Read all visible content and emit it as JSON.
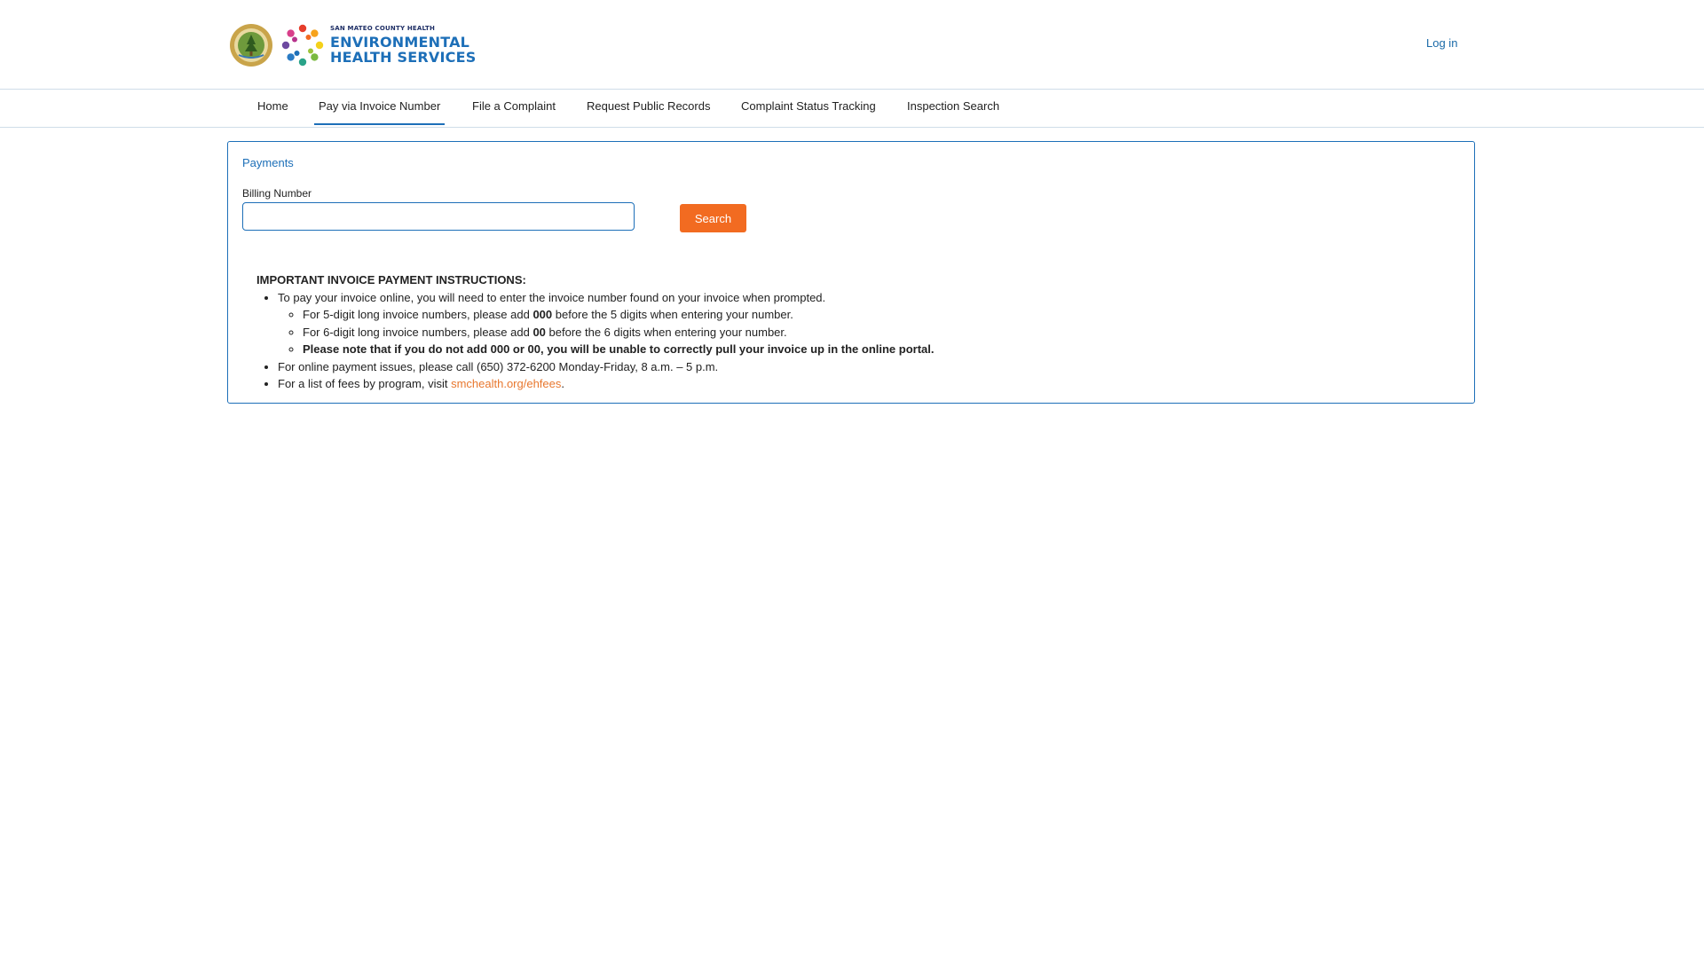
{
  "header": {
    "brand_small": "SAN MATEO COUNTY HEALTH",
    "brand_line1": "ENVIRONMENTAL",
    "brand_line2": "HEALTH SERVICES",
    "login_label": "Log in"
  },
  "nav": {
    "items": [
      {
        "label": "Home",
        "active": false
      },
      {
        "label": "Pay via Invoice Number",
        "active": true
      },
      {
        "label": "File a Complaint",
        "active": false
      },
      {
        "label": "Request Public Records",
        "active": false
      },
      {
        "label": "Complaint Status Tracking",
        "active": false
      },
      {
        "label": "Inspection Search",
        "active": false
      }
    ]
  },
  "panel": {
    "title": "Payments",
    "field_label": "Billing Number",
    "billing_value": "",
    "search_label": "Search"
  },
  "instructions": {
    "heading": "IMPORTANT INVOICE PAYMENT INSTRUCTIONS:",
    "item1": "To pay your invoice online, you will need to enter the invoice number found on your invoice when prompted.",
    "sub1_prefix": "For 5-digit long invoice numbers, please add ",
    "sub1_bold": "000",
    "sub1_suffix": " before the 5 digits when entering your number.",
    "sub2_prefix": "For 6-digit long invoice numbers, please add ",
    "sub2_bold": "00",
    "sub2_suffix": " before the 6 digits when entering your number.",
    "sub3": "Please note that if you do not add 000 or 00, you will be unable to correctly pull your invoice up in the online portal.",
    "item2": "For online payment issues, please call (650) 372-6200 Monday-Friday, 8 a.m. – 5 p.m.",
    "item3_prefix": "For a list of fees by program, visit ",
    "item3_link": "smchealth.org/ehfees",
    "item3_suffix": "."
  },
  "colors": {
    "accent_blue": "#1d6fb8",
    "button_orange": "#f26b21",
    "link_orange": "#e8772e"
  }
}
